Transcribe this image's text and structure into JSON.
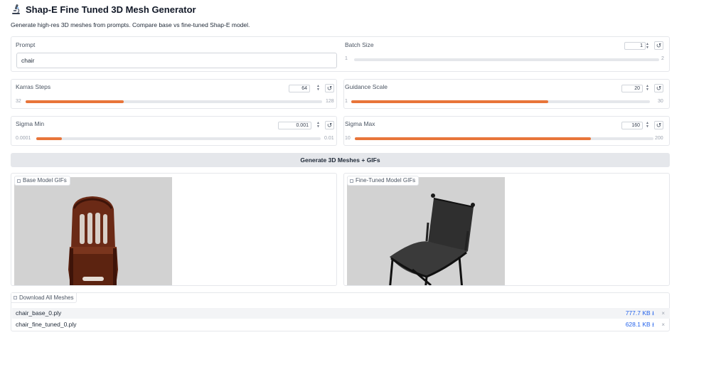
{
  "header": {
    "title": "Shap-E Fine Tuned 3D Mesh Generator",
    "description": "Generate high-res 3D meshes from prompts. Compare base vs fine-tuned Shap-E model."
  },
  "prompt": {
    "label": "Prompt",
    "value": "chair"
  },
  "batch_size": {
    "label": "Batch Size",
    "value": "1",
    "min": "1",
    "max": "2",
    "level": 0
  },
  "karras_steps": {
    "label": "Karras Steps",
    "value": "64",
    "min": "32",
    "max": "128",
    "level": 0.33
  },
  "guidance_scale": {
    "label": "Guidance Scale",
    "value": "20",
    "min": "1",
    "max": "30",
    "level": 0.66
  },
  "sigma_min": {
    "label": "Sigma Min",
    "value": "0.001",
    "min": "0.0001",
    "max": "0.01",
    "level": 0.09
  },
  "sigma_max": {
    "label": "Sigma Max",
    "value": "160",
    "min": "10",
    "max": "200",
    "level": 0.79
  },
  "generate_button": {
    "label": "Generate 3D Meshes + GIFs"
  },
  "base_gifs": {
    "label": "Base Model GIFs"
  },
  "finetuned_gifs": {
    "label": "Fine-Tuned Model GIFs"
  },
  "downloads": {
    "label": "Download All Meshes",
    "files": [
      {
        "name": "chair_base_0.ply",
        "size": "777.7 KB ⭳"
      },
      {
        "name": "chair_fine_tuned_0.ply",
        "size": "628.1 KB ⭳"
      }
    ],
    "remove_symbol": "×"
  },
  "colors": {
    "accent": "#e8753a",
    "link": "#2563eb"
  },
  "icons": {
    "title": "microscope-icon",
    "reset": "reset-icon",
    "spin": "spinner-arrows-icon"
  }
}
